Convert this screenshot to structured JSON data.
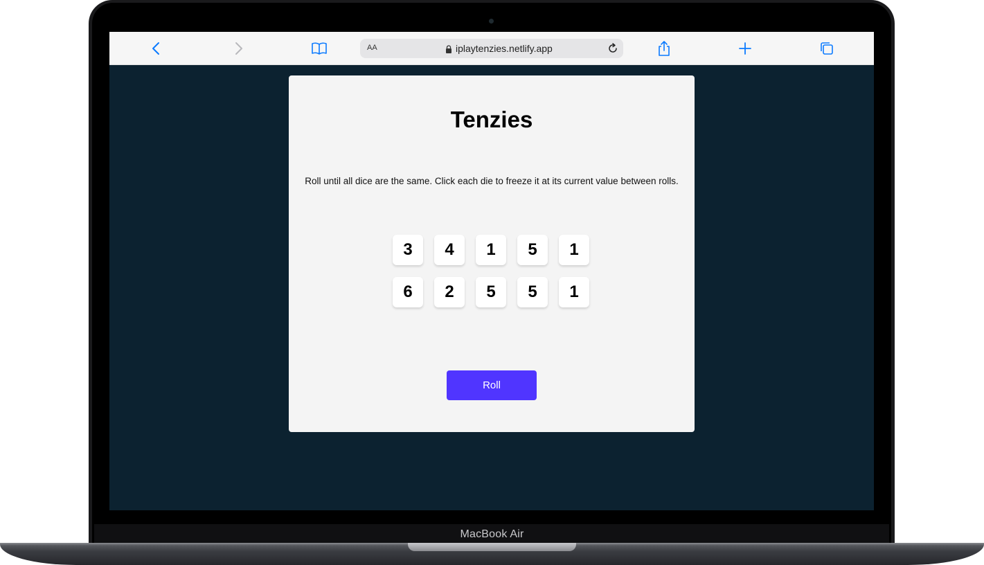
{
  "device": {
    "label": "MacBook Air"
  },
  "browser": {
    "text_size_label": "AA",
    "url": "iplaytenzies.netlify.app",
    "toolbar_icons": [
      "chevron-left-icon",
      "chevron-right-icon",
      "book-icon",
      "share-icon",
      "plus-icon",
      "tabs-icon"
    ],
    "accent_color": "#0a7aff"
  },
  "app": {
    "title": "Tenzies",
    "instructions": "Roll until all dice are the same. Click each die to freeze it at its current value between rolls.",
    "dice": [
      "3",
      "4",
      "1",
      "5",
      "1",
      "6",
      "2",
      "5",
      "5",
      "1"
    ],
    "roll_label": "Roll",
    "button_color": "#5035ff",
    "background_color": "#0c2230"
  }
}
